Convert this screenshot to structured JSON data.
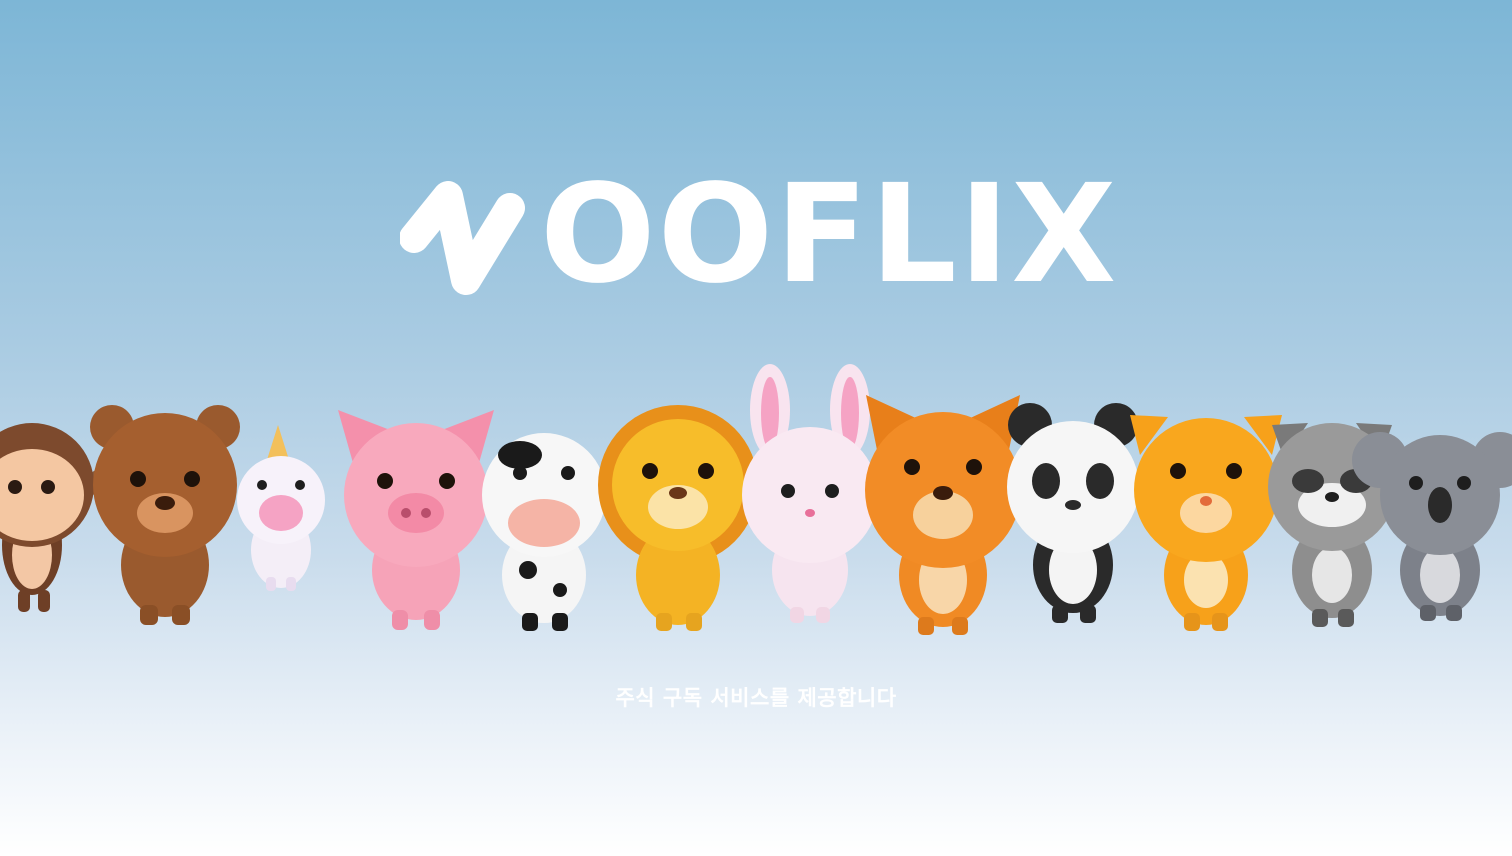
{
  "brand": {
    "name": "OOFLIX",
    "logo_color": "#ffffff"
  },
  "tagline": "주식 구독 서비스를 제공합니다",
  "characters": [
    {
      "name": "monkey",
      "color": "#8a5a3b"
    },
    {
      "name": "bear",
      "color": "#9a5a2e"
    },
    {
      "name": "unicorn",
      "color": "#f4eef7"
    },
    {
      "name": "pig",
      "color": "#f6a3b8"
    },
    {
      "name": "cow",
      "color": "#f5f5f5"
    },
    {
      "name": "lion",
      "color": "#f4b324"
    },
    {
      "name": "rabbit",
      "color": "#f6e4ef"
    },
    {
      "name": "fox",
      "color": "#f08a24"
    },
    {
      "name": "panda",
      "color": "#f4f4f4"
    },
    {
      "name": "tiger",
      "color": "#f7a11a"
    },
    {
      "name": "raccoon",
      "color": "#8e8e8e"
    },
    {
      "name": "koala",
      "color": "#7d818a"
    }
  ],
  "background": {
    "top_color": "#7db6d6",
    "bottom_color": "#ffffff"
  }
}
